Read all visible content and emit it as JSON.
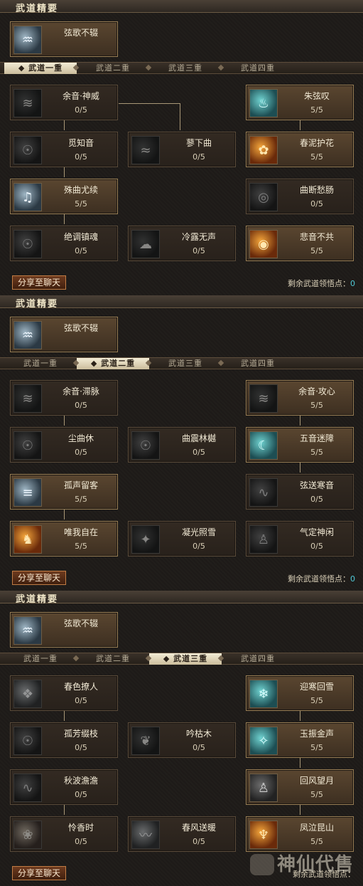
{
  "sections": [
    {
      "header": "武道精要",
      "essence": {
        "name": "弦歌不辍"
      },
      "tabs": [
        "武道一重",
        "武道二重",
        "武道三重",
        "武道四重"
      ],
      "active_tab": 0,
      "cards": [
        {
          "name": "余音·神威",
          "value": "0/5",
          "active": false,
          "icon": "fan-icon"
        },
        {
          "name": "朱弦叹",
          "value": "5/5",
          "active": true,
          "icon": "meditation-icon"
        },
        {
          "name": "觅知音",
          "value": "0/5",
          "active": false,
          "icon": "mask-icon"
        },
        {
          "name": "蓼下曲",
          "value": "0/5",
          "active": false,
          "icon": "dragon-icon"
        },
        {
          "name": "春泥护花",
          "value": "5/5",
          "active": true,
          "icon": "fire-flower-icon"
        },
        {
          "name": "殊曲尤续",
          "value": "5/5",
          "active": true,
          "icon": "music-wave-icon"
        },
        {
          "name": "曲断愁肠",
          "value": "0/5",
          "active": false,
          "icon": "swirl-icon"
        },
        {
          "name": "绝调镇魂",
          "value": "0/5",
          "active": false,
          "icon": "mask-icon"
        },
        {
          "name": "冷露无声",
          "value": "0/5",
          "active": false,
          "icon": "mist-icon"
        },
        {
          "name": "悲音不共",
          "value": "5/5",
          "active": true,
          "icon": "flame-ring-icon"
        }
      ],
      "share_label": "分享至聊天",
      "remain_label": "剩余武道领悟点：",
      "remain_value": "0"
    },
    {
      "header": "武道精要",
      "essence": {
        "name": "弦歌不辍"
      },
      "tabs": [
        "武道一重",
        "武道二重",
        "武道三重",
        "武道四重"
      ],
      "active_tab": 1,
      "cards": [
        {
          "name": "余音·滞脉",
          "value": "0/5",
          "active": false,
          "icon": "fan-icon"
        },
        {
          "name": "余音·攻心",
          "value": "5/5",
          "active": true,
          "icon": "fan-icon"
        },
        {
          "name": "尘曲休",
          "value": "0/5",
          "active": false,
          "icon": "mask-icon"
        },
        {
          "name": "曲震林樾",
          "value": "0/5",
          "active": false,
          "icon": "mask-icon"
        },
        {
          "name": "五音迷障",
          "value": "5/5",
          "active": true,
          "icon": "moon-icon"
        },
        {
          "name": "孤声留客",
          "value": "5/5",
          "active": true,
          "icon": "scroll-icon"
        },
        {
          "name": "弦送寒音",
          "value": "0/5",
          "active": false,
          "icon": "wave-icon"
        },
        {
          "name": "唯我自在",
          "value": "5/5",
          "active": true,
          "icon": "warrior-icon"
        },
        {
          "name": "凝光照雪",
          "value": "0/5",
          "active": false,
          "icon": "light-icon"
        },
        {
          "name": "气定神闲",
          "value": "0/5",
          "active": false,
          "icon": "figure-icon"
        }
      ],
      "share_label": "分享至聊天",
      "remain_label": "剩余武道领悟点：",
      "remain_value": "0"
    },
    {
      "header": "武道精要",
      "essence": {
        "name": "弦歌不辍"
      },
      "tabs": [
        "武道一重",
        "武道二重",
        "武道三重",
        "武道四重"
      ],
      "active_tab": 2,
      "cards": [
        {
          "name": "春色撩人",
          "value": "0/5",
          "active": false,
          "icon": "book-icon"
        },
        {
          "name": "迎寒回雪",
          "value": "5/5",
          "active": true,
          "icon": "crystal-icon"
        },
        {
          "name": "孤芳缀枝",
          "value": "0/5",
          "active": false,
          "icon": "mask-icon"
        },
        {
          "name": "吟枯木",
          "value": "0/5",
          "active": false,
          "icon": "leaf-icon"
        },
        {
          "name": "玉振金声",
          "value": "5/5",
          "active": true,
          "icon": "sparkle-icon"
        },
        {
          "name": "秋波澹澹",
          "value": "0/5",
          "active": false,
          "icon": "wave-icon"
        },
        {
          "name": "回风望月",
          "value": "5/5",
          "active": true,
          "icon": "figure-icon"
        },
        {
          "name": "怜香时",
          "value": "0/5",
          "active": false,
          "icon": "flower-icon"
        },
        {
          "name": "春风送暖",
          "value": "0/5",
          "active": false,
          "icon": "wind-icon"
        },
        {
          "name": "凤泣昆山",
          "value": "5/5",
          "active": true,
          "icon": "phoenix-icon"
        }
      ],
      "share_label": "分享至聊天",
      "remain_label": "剩余武道领悟点：",
      "remain_value": ""
    }
  ],
  "watermark": {
    "text": "神仙代售"
  }
}
